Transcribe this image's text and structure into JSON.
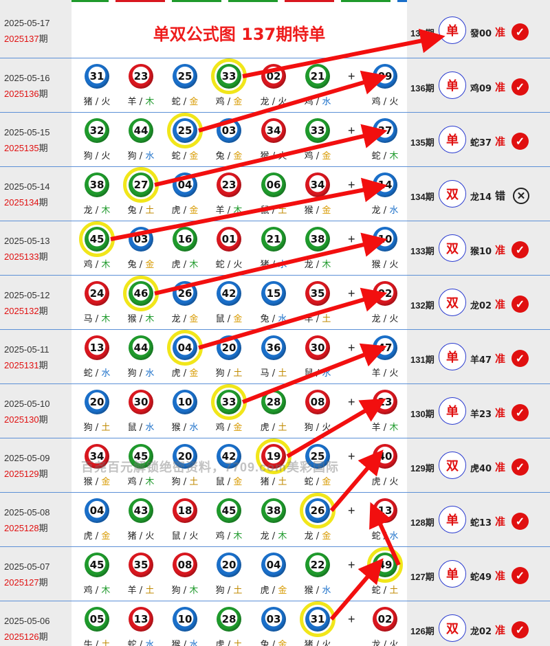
{
  "header": {
    "date": "2025-05-17",
    "period_code": "2025137",
    "period_suffix": "期",
    "title": "单双公式图 137期特单",
    "result": {
      "period": "137期",
      "pick": "单",
      "zodiac": "發00",
      "status": "准"
    }
  },
  "watermark": "百尧百元解锁绝密资料，7709.com美彩国际",
  "plus_sign": "+",
  "colors": {
    "red": "#d9171f",
    "green": "#1f9a2c",
    "blue": "#1a6fc9",
    "highlight": "#f1e61a",
    "accent": "#e01010"
  },
  "rows": [
    {
      "date": "2025-05-16",
      "code": "2025136",
      "hl": 3,
      "balls": [
        [
          "31",
          "b",
          "猪",
          "火"
        ],
        [
          "23",
          "r",
          "羊",
          "木"
        ],
        [
          "25",
          "b",
          "蛇",
          "金"
        ],
        [
          "33",
          "g",
          "鸡",
          "金"
        ],
        [
          "02",
          "r",
          "龙",
          "火"
        ],
        [
          "21",
          "g",
          "鸡",
          "水"
        ],
        [
          "09",
          "b",
          "鸡",
          "火"
        ]
      ],
      "result": {
        "period": "136期",
        "pick": "单",
        "zodiac": "鸡09",
        "status": "准"
      }
    },
    {
      "date": "2025-05-15",
      "code": "2025135",
      "hl": 2,
      "balls": [
        [
          "32",
          "g",
          "狗",
          "火"
        ],
        [
          "44",
          "g",
          "狗",
          "水"
        ],
        [
          "25",
          "b",
          "蛇",
          "金"
        ],
        [
          "03",
          "b",
          "兔",
          "金"
        ],
        [
          "34",
          "r",
          "猴",
          "火"
        ],
        [
          "33",
          "g",
          "鸡",
          "金"
        ],
        [
          "37",
          "b",
          "蛇",
          "木"
        ]
      ],
      "result": {
        "period": "135期",
        "pick": "单",
        "zodiac": "蛇37",
        "status": "准"
      }
    },
    {
      "date": "2025-05-14",
      "code": "2025134",
      "hl": 1,
      "balls": [
        [
          "38",
          "g",
          "龙",
          "木"
        ],
        [
          "27",
          "g",
          "兔",
          "土"
        ],
        [
          "04",
          "b",
          "虎",
          "金"
        ],
        [
          "23",
          "r",
          "羊",
          "木"
        ],
        [
          "06",
          "g",
          "鼠",
          "土"
        ],
        [
          "34",
          "r",
          "猴",
          "金"
        ],
        [
          "14",
          "b",
          "龙",
          "水"
        ]
      ],
      "result": {
        "period": "134期",
        "pick": "双",
        "zodiac": "龙14",
        "status": "错"
      }
    },
    {
      "date": "2025-05-13",
      "code": "2025133",
      "hl": 0,
      "balls": [
        [
          "45",
          "g",
          "鸡",
          "木"
        ],
        [
          "03",
          "b",
          "兔",
          "金"
        ],
        [
          "16",
          "g",
          "虎",
          "木"
        ],
        [
          "01",
          "r",
          "蛇",
          "火"
        ],
        [
          "21",
          "g",
          "猪",
          "水"
        ],
        [
          "38",
          "g",
          "龙",
          "木"
        ],
        [
          "10",
          "b",
          "猴",
          "火"
        ]
      ],
      "result": {
        "period": "133期",
        "pick": "双",
        "zodiac": "猴10",
        "status": "准"
      }
    },
    {
      "date": "2025-05-12",
      "code": "2025132",
      "hl": 1,
      "balls": [
        [
          "24",
          "r",
          "马",
          "木"
        ],
        [
          "46",
          "g",
          "猴",
          "木"
        ],
        [
          "26",
          "b",
          "龙",
          "金"
        ],
        [
          "42",
          "b",
          "鼠",
          "金"
        ],
        [
          "15",
          "b",
          "兔",
          "水"
        ],
        [
          "35",
          "r",
          "羊",
          "土"
        ],
        [
          "02",
          "r",
          "龙",
          "火"
        ]
      ],
      "result": {
        "period": "132期",
        "pick": "双",
        "zodiac": "龙02",
        "status": "准"
      }
    },
    {
      "date": "2025-05-11",
      "code": "2025131",
      "hl": 2,
      "balls": [
        [
          "13",
          "r",
          "蛇",
          "水"
        ],
        [
          "44",
          "g",
          "狗",
          "水"
        ],
        [
          "04",
          "b",
          "虎",
          "金"
        ],
        [
          "20",
          "b",
          "狗",
          "土"
        ],
        [
          "36",
          "b",
          "马",
          "土"
        ],
        [
          "30",
          "r",
          "鼠",
          "水"
        ],
        [
          "47",
          "b",
          "羊",
          "火"
        ]
      ],
      "result": {
        "period": "131期",
        "pick": "单",
        "zodiac": "羊47",
        "status": "准"
      }
    },
    {
      "date": "2025-05-10",
      "code": "2025130",
      "hl": 3,
      "balls": [
        [
          "20",
          "b",
          "狗",
          "土"
        ],
        [
          "30",
          "r",
          "鼠",
          "水"
        ],
        [
          "10",
          "b",
          "猴",
          "水"
        ],
        [
          "33",
          "g",
          "鸡",
          "金"
        ],
        [
          "28",
          "g",
          "虎",
          "土"
        ],
        [
          "08",
          "r",
          "狗",
          "火"
        ],
        [
          "23",
          "r",
          "羊",
          "木"
        ]
      ],
      "result": {
        "period": "130期",
        "pick": "单",
        "zodiac": "羊23",
        "status": "准"
      }
    },
    {
      "date": "2025-05-09",
      "code": "2025129",
      "hl": 4,
      "balls": [
        [
          "34",
          "r",
          "猴",
          "金"
        ],
        [
          "45",
          "g",
          "鸡",
          "木"
        ],
        [
          "20",
          "b",
          "狗",
          "土"
        ],
        [
          "42",
          "b",
          "鼠",
          "金"
        ],
        [
          "19",
          "r",
          "猪",
          "土"
        ],
        [
          "25",
          "b",
          "蛇",
          "金"
        ],
        [
          "40",
          "r",
          "虎",
          "火"
        ]
      ],
      "result": {
        "period": "129期",
        "pick": "双",
        "zodiac": "虎40",
        "status": "准"
      }
    },
    {
      "date": "2025-05-08",
      "code": "2025128",
      "hl": 5,
      "balls": [
        [
          "04",
          "b",
          "虎",
          "金"
        ],
        [
          "43",
          "g",
          "猪",
          "火"
        ],
        [
          "18",
          "r",
          "鼠",
          "火"
        ],
        [
          "45",
          "g",
          "鸡",
          "木"
        ],
        [
          "38",
          "g",
          "龙",
          "木"
        ],
        [
          "26",
          "b",
          "龙",
          "金"
        ],
        [
          "13",
          "r",
          "蛇",
          "水"
        ]
      ],
      "result": {
        "period": "128期",
        "pick": "单",
        "zodiac": "蛇13",
        "status": "准"
      }
    },
    {
      "date": "2025-05-07",
      "code": "2025127",
      "hl": 6,
      "balls": [
        [
          "45",
          "g",
          "鸡",
          "木"
        ],
        [
          "35",
          "r",
          "羊",
          "土"
        ],
        [
          "08",
          "r",
          "狗",
          "木"
        ],
        [
          "20",
          "b",
          "狗",
          "土"
        ],
        [
          "04",
          "b",
          "虎",
          "金"
        ],
        [
          "22",
          "g",
          "猴",
          "水"
        ],
        [
          "49",
          "g",
          "蛇",
          "土"
        ]
      ],
      "result": {
        "period": "127期",
        "pick": "单",
        "zodiac": "蛇49",
        "status": "准"
      }
    },
    {
      "date": "2025-05-06",
      "code": "2025126",
      "hl": 5,
      "balls": [
        [
          "05",
          "g",
          "牛",
          "土"
        ],
        [
          "13",
          "r",
          "蛇",
          "水"
        ],
        [
          "10",
          "b",
          "猴",
          "水"
        ],
        [
          "28",
          "g",
          "虎",
          "土"
        ],
        [
          "03",
          "b",
          "兔",
          "金"
        ],
        [
          "31",
          "b",
          "猪",
          "火"
        ],
        [
          "02",
          "r",
          "龙",
          "火"
        ]
      ],
      "result": {
        "period": "126期",
        "pick": "双",
        "zodiac": "龙02",
        "status": "准"
      }
    }
  ]
}
